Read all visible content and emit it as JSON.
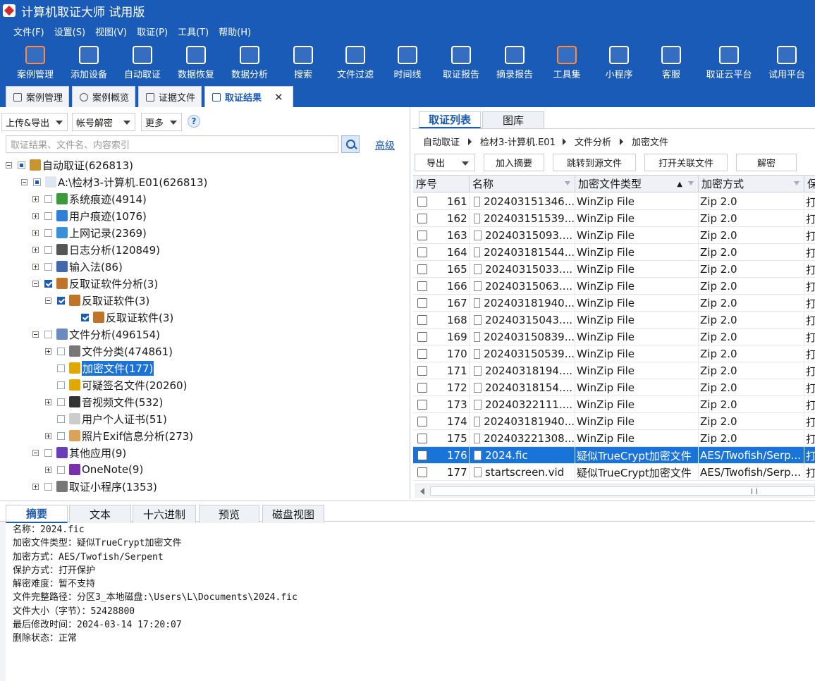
{
  "window": {
    "title": "计算机取证大师 试用版"
  },
  "menu": [
    "文件(F)",
    "设置(S)",
    "视图(V)",
    "取证(P)",
    "工具(T)",
    "帮助(H)"
  ],
  "toolbar": [
    {
      "label": "案例管理",
      "icon": "case-folder-icon",
      "color": "#ff8a3d"
    },
    {
      "label": "添加设备",
      "icon": "add-device-icon",
      "color": "#ffffff"
    },
    {
      "label": "自动取证",
      "icon": "auto-forensic-icon",
      "color": "#ffffff"
    },
    {
      "label": "数据恢复",
      "icon": "data-recovery-icon",
      "color": "#ffffff"
    },
    {
      "label": "数据分析",
      "icon": "data-analysis-icon",
      "color": "#ffffff"
    },
    {
      "label": "搜索",
      "icon": "search-doc-icon",
      "color": "#ffffff"
    },
    {
      "label": "文件过滤",
      "icon": "file-filter-icon",
      "color": "#ffffff"
    },
    {
      "label": "时间线",
      "icon": "timeline-icon",
      "color": "#ffffff"
    },
    {
      "label": "取证报告",
      "icon": "forensic-report-icon",
      "color": "#ffffff"
    },
    {
      "label": "摘录报告",
      "icon": "excerpt-report-icon",
      "color": "#ffffff"
    },
    {
      "label": "工具集",
      "icon": "toolset-icon",
      "color": "#ff8a3d"
    },
    {
      "label": "小程序",
      "icon": "mini-program-icon",
      "color": "#ffffff"
    },
    {
      "label": "客服",
      "icon": "customer-service-icon",
      "color": "#ffffff"
    },
    {
      "label": "取证云平台",
      "icon": "cloud-platform-icon",
      "color": "#ffffff"
    },
    {
      "label": "试用平台",
      "icon": "trial-platform-icon",
      "color": "#ffffff"
    }
  ],
  "doc_tabs": [
    {
      "label": "案例管理",
      "active": false
    },
    {
      "label": "案例概览",
      "active": false
    },
    {
      "label": "证据文件",
      "active": false
    },
    {
      "label": "取证结果",
      "active": true,
      "close": "✕"
    }
  ],
  "left": {
    "buttons": [
      "上传&导出",
      "帐号解密",
      "更多"
    ],
    "help": "?",
    "search_placeholder": "取证结果、文件名、内容索引",
    "advanced": "高级",
    "tree": [
      {
        "label": "自动取证(626813)",
        "depth": 0,
        "exp": "minus",
        "cb": "part",
        "icon_color": "#c8962e"
      },
      {
        "label": "A:\\检材3-计算机.E01(626813)",
        "depth": 1,
        "exp": "minus",
        "cb": "part",
        "icon_color": "#dfe6ef"
      },
      {
        "label": "系统痕迹(4914)",
        "depth": 2,
        "exp": "plus",
        "cb": "off",
        "icon_color": "#3b9b3b"
      },
      {
        "label": "用户痕迹(1076)",
        "depth": 2,
        "exp": "plus",
        "cb": "off",
        "icon_color": "#2f7fd6"
      },
      {
        "label": "上网记录(2369)",
        "depth": 2,
        "exp": "plus",
        "cb": "off",
        "icon_color": "#3a8fd9"
      },
      {
        "label": "日志分析(120849)",
        "depth": 2,
        "exp": "plus",
        "cb": "off",
        "icon_color": "#555555"
      },
      {
        "label": "输入法(86)",
        "depth": 2,
        "exp": "plus",
        "cb": "off",
        "icon_color": "#4466aa"
      },
      {
        "label": "反取证软件分析(3)",
        "depth": 2,
        "exp": "minus",
        "cb": "on",
        "icon_color": "#c0742a"
      },
      {
        "label": "反取证软件(3)",
        "depth": 3,
        "exp": "minus",
        "cb": "on",
        "icon_color": "#c0742a"
      },
      {
        "label": "反取证软件(3)",
        "depth": 4,
        "exp": "none",
        "cb": "on",
        "icon_color": "#c0742a"
      },
      {
        "label": "文件分析(496154)",
        "depth": 2,
        "exp": "minus",
        "cb": "off",
        "icon_color": "#6b8bbf"
      },
      {
        "label": "文件分类(474861)",
        "depth": 3,
        "exp": "plus",
        "cb": "off",
        "icon_color": "#777777"
      },
      {
        "label": "加密文件(177)",
        "depth": 3,
        "exp": "none",
        "cb": "off",
        "icon_color": "#e0a800",
        "selected": true
      },
      {
        "label": "可疑签名文件(20260)",
        "depth": 3,
        "exp": "none",
        "cb": "off",
        "icon_color": "#e0a800"
      },
      {
        "label": "音视频文件(532)",
        "depth": 3,
        "exp": "plus",
        "cb": "off",
        "icon_color": "#333333"
      },
      {
        "label": "用户个人证书(51)",
        "depth": 3,
        "exp": "none",
        "cb": "off",
        "icon_color": "#cccccc"
      },
      {
        "label": "照片Exif信息分析(273)",
        "depth": 3,
        "exp": "plus",
        "cb": "off",
        "icon_color": "#d9a35a"
      },
      {
        "label": "其他应用(9)",
        "depth": 2,
        "exp": "minus",
        "cb": "off",
        "icon_color": "#6a3fb5"
      },
      {
        "label": "OneNote(9)",
        "depth": 3,
        "exp": "plus",
        "cb": "off",
        "icon_color": "#7b2fa8"
      },
      {
        "label": "取证小程序(1353)",
        "depth": 2,
        "exp": "plus",
        "cb": "off",
        "icon_color": "#777777"
      }
    ]
  },
  "right": {
    "tabs": [
      {
        "label": "取证列表",
        "active": true
      },
      {
        "label": "图库",
        "active": false
      }
    ],
    "breadcrumb": [
      "自动取证",
      "检材3-计算机.E01",
      "文件分析",
      "加密文件"
    ],
    "buttons": [
      "导出",
      "加入摘要",
      "跳转到源文件",
      "打开关联文件",
      "解密"
    ],
    "columns": [
      "序号",
      "名称",
      "加密文件类型",
      "加密方式",
      "保"
    ],
    "rows": [
      {
        "no": "161",
        "name": "202403151346...",
        "type": "WinZip File",
        "method": "Zip 2.0",
        "prot": "打"
      },
      {
        "no": "162",
        "name": "202403151539...",
        "type": "WinZip File",
        "method": "Zip 2.0",
        "prot": "打"
      },
      {
        "no": "163",
        "name": "20240315093....",
        "type": "WinZip File",
        "method": "Zip 2.0",
        "prot": "打"
      },
      {
        "no": "164",
        "name": "202403181544...",
        "type": "WinZip File",
        "method": "Zip 2.0",
        "prot": "打"
      },
      {
        "no": "165",
        "name": "20240315033....",
        "type": "WinZip File",
        "method": "Zip 2.0",
        "prot": "打"
      },
      {
        "no": "166",
        "name": "20240315063....",
        "type": "WinZip File",
        "method": "Zip 2.0",
        "prot": "打"
      },
      {
        "no": "167",
        "name": "202403181940...",
        "type": "WinZip File",
        "method": "Zip 2.0",
        "prot": "打"
      },
      {
        "no": "168",
        "name": "20240315043....",
        "type": "WinZip File",
        "method": "Zip 2.0",
        "prot": "打"
      },
      {
        "no": "169",
        "name": "202403150839...",
        "type": "WinZip File",
        "method": "Zip 2.0",
        "prot": "打"
      },
      {
        "no": "170",
        "name": "202403150539...",
        "type": "WinZip File",
        "method": "Zip 2.0",
        "prot": "打"
      },
      {
        "no": "171",
        "name": "20240318194....",
        "type": "WinZip File",
        "method": "Zip 2.0",
        "prot": "打"
      },
      {
        "no": "172",
        "name": "20240318154....",
        "type": "WinZip File",
        "method": "Zip 2.0",
        "prot": "打"
      },
      {
        "no": "173",
        "name": "20240322111....",
        "type": "WinZip File",
        "method": "Zip 2.0",
        "prot": "打"
      },
      {
        "no": "174",
        "name": "202403181940...",
        "type": "WinZip File",
        "method": "Zip 2.0",
        "prot": "打"
      },
      {
        "no": "175",
        "name": "202403221308...",
        "type": "WinZip File",
        "method": "Zip 2.0",
        "prot": "打"
      },
      {
        "no": "176",
        "name": "2024.fic",
        "type": "疑似TrueCrypt加密文件",
        "method": "AES/Twofish/Serp...",
        "prot": "打",
        "selected": true
      },
      {
        "no": "177",
        "name": "startscreen.vid",
        "type": "疑似TrueCrypt加密文件",
        "method": "AES/Twofish/Serp...",
        "prot": "打"
      }
    ]
  },
  "bottom": {
    "tabs": [
      {
        "label": "摘要",
        "active": true
      },
      {
        "label": "文本"
      },
      {
        "label": "十六进制"
      },
      {
        "label": "预览"
      },
      {
        "label": "磁盘视图"
      }
    ],
    "details": [
      "名称：2024.fic",
      "加密文件类型：疑似TrueCrypt加密文件",
      "加密方式：AES/Twofish/Serpent",
      "保护方式：打开保护",
      "解密难度：暂不支持",
      "文件完整路径：分区3_本地磁盘:\\Users\\L\\Documents\\2024.fic",
      "文件大小（字节）：52428800",
      "最后修改时间：2024-03-14 17:20:07",
      "删除状态：正常"
    ]
  },
  "colors": {
    "brand": "#1a5bb8",
    "selection": "#1a73d9"
  }
}
